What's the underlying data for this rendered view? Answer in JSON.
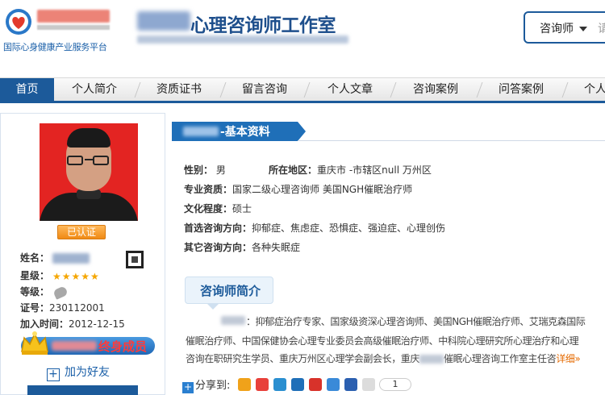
{
  "header": {
    "logo_tagline": "国际心身健康产业服务平台",
    "site_title": "心理咨询师工作室",
    "search_select": "咨询师",
    "search_placeholder": "请"
  },
  "nav": {
    "items": [
      {
        "label": "首页",
        "active": true
      },
      {
        "label": "个人简介",
        "active": false
      },
      {
        "label": "资质证书",
        "active": false
      },
      {
        "label": "留言咨询",
        "active": false
      },
      {
        "label": "个人文章",
        "active": false
      },
      {
        "label": "咨询案例",
        "active": false
      },
      {
        "label": "问答案例",
        "active": false
      },
      {
        "label": "个人",
        "active": false
      }
    ]
  },
  "profile": {
    "verified_badge": "已认证",
    "name_label": "姓名：",
    "stars_label": "星级：",
    "stars": "★★★★★",
    "level_label": "等级：",
    "cert_label": "证号：",
    "cert_value": "230112001",
    "join_label": "加入时间：",
    "join_value": "2012-12-15",
    "member_text": "终身成员",
    "add_friend": "加为好友"
  },
  "basic": {
    "ribbon_title": "-基本资料",
    "gender_label": "性别：",
    "gender_value": "男",
    "region_label": "所在地区：",
    "region_value": "重庆市 -市辖区null    万州区",
    "qualification_label": "专业资质：",
    "qualification_value": "国家二级心理咨询师 美国NGH催眠治疗师",
    "education_label": "文化程度：",
    "education_value": "硕士",
    "preferred_label": "首选咨询方向：",
    "preferred_value": "抑郁症、焦虑症、恐惧症、强迫症、心理创伤",
    "other_label": "其它咨询方向：",
    "other_value": "各种失眠症"
  },
  "intro": {
    "title": "咨询师简介",
    "line1": "：抑郁症治疗专家、国家级资深心理咨询师、美国NGH催眠治疗师、艾瑞克森国际",
    "line2": "催眠治疗师、中国保健协会心理专业委员会高级催眠治疗师、中科院心理研究所心理治疗和心理",
    "line3a": "咨询在职研究生学员、重庆万州区心理学会副会长，重庆",
    "line3b": "催眠心理咨询工作室主任咨",
    "detail_link": "详细»"
  },
  "share": {
    "label": "分享到:",
    "count": "1"
  },
  "colors": {
    "brand_blue": "#1c5a9a",
    "ribbon_blue": "#1f6fb8",
    "member_red": "#ff3b3b",
    "link_orange": "#e56a00"
  }
}
